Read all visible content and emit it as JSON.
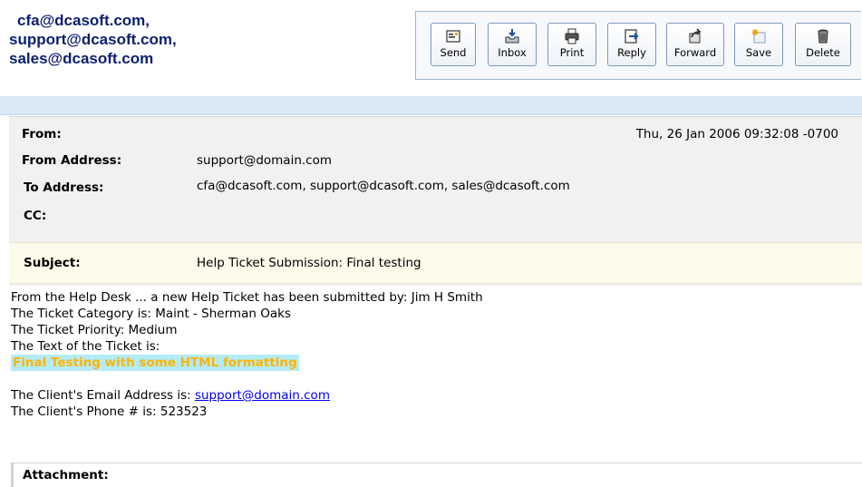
{
  "header": {
    "recipients": [
      "cfa@dcasoft.com,",
      "support@dcasoft.com,",
      "sales@dcasoft.com"
    ]
  },
  "toolbar": {
    "buttons": [
      {
        "label": "Send",
        "icon": "send-icon"
      },
      {
        "label": "Inbox",
        "icon": "inbox-icon"
      },
      {
        "label": "Print",
        "icon": "print-icon"
      },
      {
        "label": "Reply",
        "icon": "reply-icon"
      },
      {
        "label": "Forward",
        "icon": "forward-icon"
      },
      {
        "label": "Save",
        "icon": "save-icon"
      },
      {
        "label": "Delete",
        "icon": "delete-icon"
      }
    ]
  },
  "message": {
    "from_label": "From:",
    "from_value": "",
    "date": "Thu, 26 Jan 2006 09:32:08 -0700",
    "from_address_label": "From Address:",
    "from_address": "support@domain.com",
    "to_address_label": "To Address:",
    "to_address": "cfa@dcasoft.com, support@dcasoft.com, sales@dcasoft.com",
    "cc_label": "CC:",
    "cc_value": "",
    "subject_label": "Subject:",
    "subject": "Help Ticket Submission: Final testing"
  },
  "body": {
    "line1": "From the Help Desk ... a new Help Ticket has been submitted by: Jim H Smith",
    "line2": "The Ticket Category is: Maint - Sherman Oaks",
    "line3": "The Ticket Priority: Medium",
    "line4": "The Text of the Ticket is:",
    "highlight": "Final Testing with some HTML formatting",
    "email_prefix": "The Client's Email Address is: ",
    "email_link": "support@domain.com",
    "phone": "The Client's Phone # is: 523523"
  },
  "attachment": {
    "label": "Attachment:"
  },
  "colors": {
    "recipient_text": "#0b1f6e",
    "highlight_bg": "#b3ecf6",
    "highlight_text": "#ffb400",
    "subject_bg": "#fdfbe9",
    "header_bar": "#dbe8f5"
  }
}
